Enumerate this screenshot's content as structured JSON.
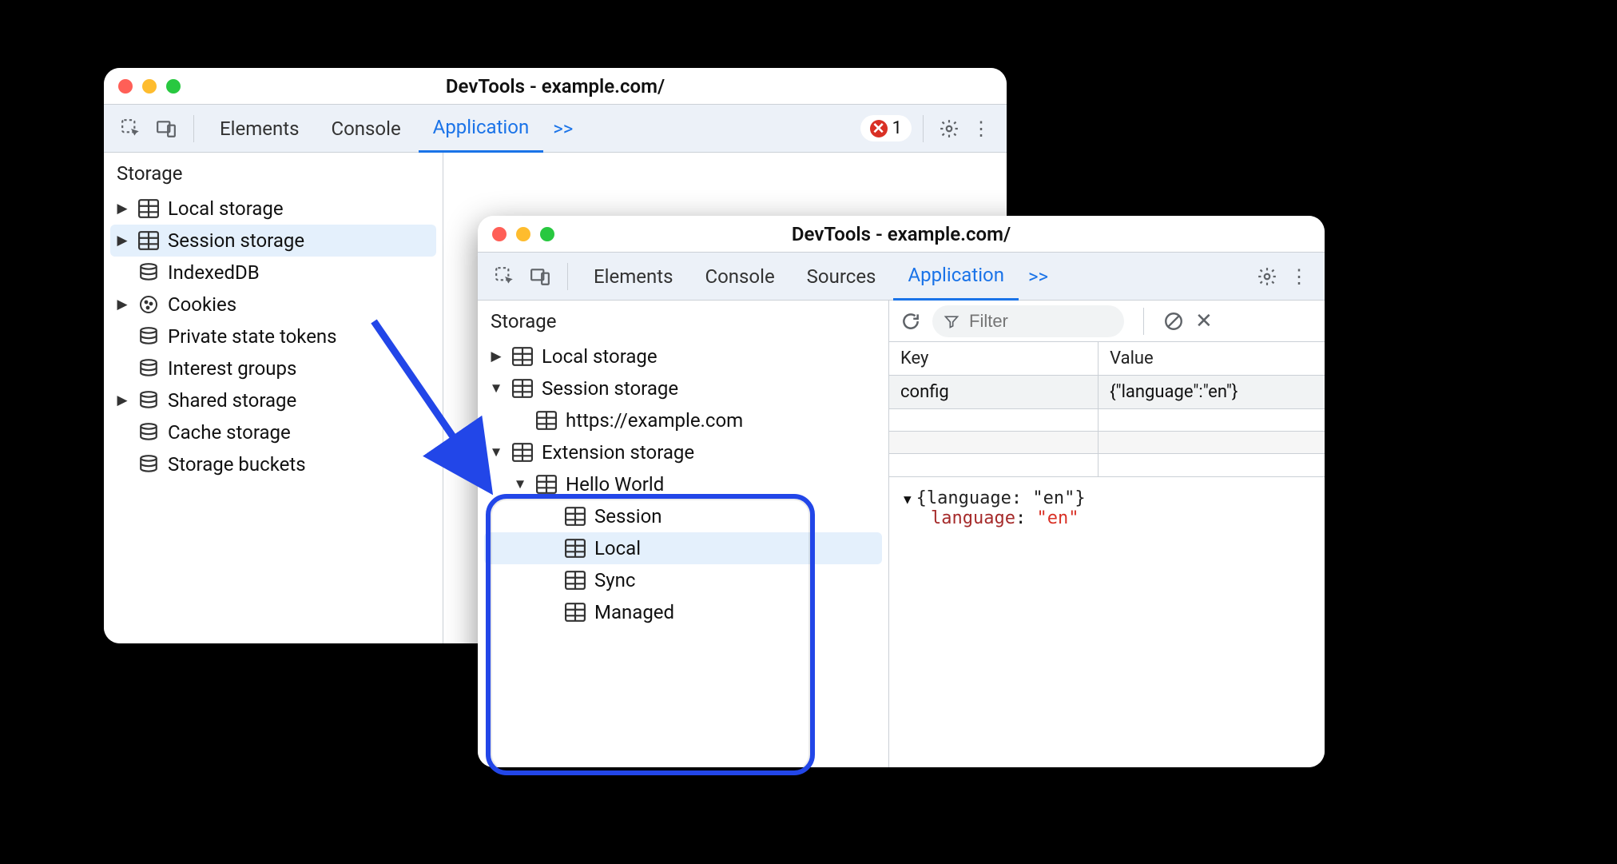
{
  "left": {
    "title": "DevTools - example.com/",
    "tabs": {
      "elements": "Elements",
      "console": "Console",
      "application": "Application"
    },
    "moreTabs": ">>",
    "errorCount": "1",
    "section": "Storage",
    "nodes": {
      "local": "Local storage",
      "session": "Session storage",
      "indexed": "IndexedDB",
      "cookies": "Cookies",
      "pst": "Private state tokens",
      "interest": "Interest groups",
      "shared": "Shared storage",
      "cache": "Cache storage",
      "buckets": "Storage buckets"
    }
  },
  "right": {
    "title": "DevTools - example.com/",
    "tabs": {
      "elements": "Elements",
      "console": "Console",
      "sources": "Sources",
      "application": "Application"
    },
    "moreTabs": ">>",
    "section": "Storage",
    "nodes": {
      "local": "Local storage",
      "session": "Session storage",
      "sessionChild": "https://example.com",
      "ext": "Extension storage",
      "hello": "Hello World",
      "h_session": "Session",
      "h_local": "Local",
      "h_sync": "Sync",
      "h_managed": "Managed"
    },
    "filterPlaceholder": "Filter",
    "table": {
      "keyHeader": "Key",
      "valHeader": "Value",
      "row": {
        "key": "config",
        "value": "{\"language\":\"en\"}"
      }
    },
    "preview": {
      "summary": "{language: \"en\"}",
      "key": "language",
      "colon": ": ",
      "value": "\"en\""
    }
  }
}
